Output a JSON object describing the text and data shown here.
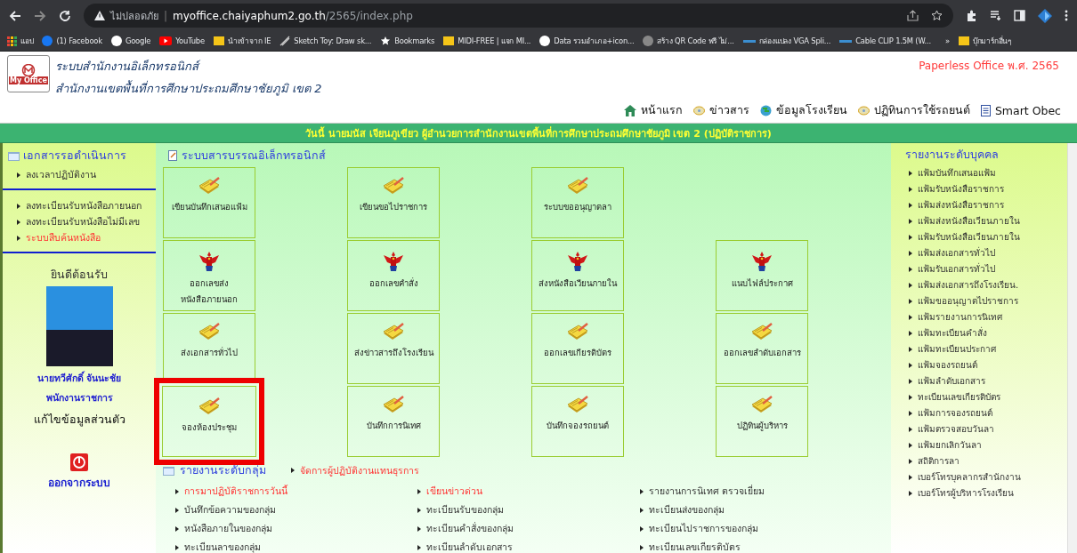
{
  "browser": {
    "security": "ไม่ปลอดภัย",
    "separator": "|",
    "url_host": "myoffice.chaiyaphum2.go.th",
    "url_path": "/2565/index.php",
    "bookmarks": [
      {
        "kind": "apps",
        "label": "แอป"
      },
      {
        "kind": "facebook",
        "label": "(1) Facebook"
      },
      {
        "kind": "google",
        "label": "Google"
      },
      {
        "kind": "youtube",
        "label": "YouTube"
      },
      {
        "kind": "folder",
        "label": "นำเข้าจาก IE"
      },
      {
        "kind": "sketch",
        "label": "Sketch Toy: Draw sk..."
      },
      {
        "kind": "star",
        "label": "Bookmarks"
      },
      {
        "kind": "midi",
        "label": "MIDI-FREE | แจก MI..."
      },
      {
        "kind": "google",
        "label": "Data รวมอำเภอ+icon..."
      },
      {
        "kind": "qr",
        "label": "สร้าง QR Code ฟรี ไม่..."
      },
      {
        "kind": "line",
        "label": "กล่องแปลง VGA Spli..."
      },
      {
        "kind": "line",
        "label": "Cable CLIP 1.5M (W..."
      }
    ],
    "more": "»",
    "other_bookmarks": "บุ๊กมาร์กอื่นๆ"
  },
  "header": {
    "logo_text": "My Office",
    "title": "ระบบสำนักงานอิเล็กทรอนิกส์",
    "subtitle": "สำนักงานเขตพื้นที่การศึกษาประถมศึกษาชัยภูมิ เขต 2",
    "edition": "Paperless Office พ.ศ. 2565",
    "nav": [
      {
        "kind": "home",
        "label": "หน้าแรก"
      },
      {
        "kind": "disc",
        "label": "ข่าวสาร"
      },
      {
        "kind": "globe",
        "label": "ข้อมูลโรงเรียน"
      },
      {
        "kind": "disc",
        "label": "ปฏิทินการใช้รถยนต์"
      },
      {
        "kind": "doc",
        "label": "Smart Obec"
      }
    ]
  },
  "status_banner": "วันนี้ นายมนัส เจียนภูเขียว ผู้อำนวยการสำนักงานเขตพื้นที่การศึกษาประถมศึกษาชัยภูมิ เขต 2 (ปฏิบัติราชการ)",
  "left_sidebar": {
    "heading": "เอกสารรอดำเนินการ",
    "groups": [
      [
        {
          "label": "ลงเวลาปฏิบัติงาน",
          "highlighted": false
        }
      ],
      [
        {
          "label": "ลงทะเบียนรับหนังสือภายนอก",
          "highlighted": false
        },
        {
          "label": "ลงทะเบียนรับหนังสือไม่มีเลข",
          "highlighted": false
        },
        {
          "label": "ระบบสืบค้นหนังสือ",
          "highlighted": true
        }
      ]
    ],
    "welcome": "ยินดีต้อนรับ",
    "user_name": "นายทวีศักดิ์ จันนะชัย",
    "user_position": "พนักงานราชการ",
    "edit_profile": "แก้ไขข้อมูลส่วนตัว",
    "logout": "ออกจากระบบ"
  },
  "main": {
    "heading": "ระบบสารบรรณอิเล็กทรอนิกส์",
    "tile_rows": [
      [
        {
          "kind": "notepad",
          "lines": [
            "เขียนบันทึกเสนอแฟ้ม"
          ],
          "highlighted": false
        },
        {
          "kind": "notepad",
          "lines": [
            "เขียนขอไปราชการ"
          ],
          "highlighted": false
        },
        {
          "kind": "notepad",
          "lines": [
            "ระบบขออนุญาตลา"
          ],
          "highlighted": false
        }
      ],
      [
        {
          "kind": "garuda",
          "lines": [
            "ออกเลขส่ง",
            "หนังสือภายนอก"
          ],
          "highlighted": false
        },
        {
          "kind": "garuda",
          "lines": [
            "ออกเลขคำสั่ง"
          ],
          "highlighted": false
        },
        {
          "kind": "garuda",
          "lines": [
            "ส่งหนังสือเวียนภายใน"
          ],
          "highlighted": false
        },
        {
          "kind": "garuda",
          "lines": [
            "แนบไฟล์ประกาศ"
          ],
          "highlighted": false
        }
      ],
      [
        {
          "kind": "notepad",
          "lines": [
            "ส่งเอกสารทั่วไป"
          ],
          "highlighted": false
        },
        {
          "kind": "notepad",
          "lines": [
            "ส่งข่าวสารถึงโรงเรียน"
          ],
          "highlighted": false
        },
        {
          "kind": "notepad",
          "lines": [
            "ออกเลขเกียรติบัตร"
          ],
          "highlighted": false
        },
        {
          "kind": "notepad",
          "lines": [
            "ออกเลขลำดับเอกสาร"
          ],
          "highlighted": false
        }
      ],
      [
        {
          "kind": "notepad",
          "lines": [
            "จองห้องประชุม"
          ],
          "highlighted": true
        },
        {
          "kind": "notepad",
          "lines": [
            "บันทึกการนิเทศ"
          ],
          "highlighted": false
        },
        {
          "kind": "notepad",
          "lines": [
            "บันทึกจองรถยนต์"
          ],
          "highlighted": false
        },
        {
          "kind": "notepad",
          "lines": [
            "ปฏิทินผู้บริหาร"
          ],
          "highlighted": false
        }
      ]
    ],
    "group_heading": "รายงานระดับกลุ่ม",
    "group_manage": "จัดการผู้ปฏิบัติงานแทนธุรการ",
    "group_links": [
      [
        {
          "label": "การมาปฏิบัติราชการวันนี้",
          "highlighted": true
        },
        {
          "label": "บันทึกข้อความของกลุ่ม",
          "highlighted": false
        },
        {
          "label": "หนังสือภายในของกลุ่ม",
          "highlighted": false
        },
        {
          "label": "ทะเบียนลาของกลุ่ม",
          "highlighted": false
        }
      ],
      [
        {
          "label": "เขียนข่าวด่วน",
          "highlighted": true
        },
        {
          "label": "ทะเบียนรับของกลุ่ม",
          "highlighted": false
        },
        {
          "label": "ทะเบียนคำสั่งของกลุ่ม",
          "highlighted": false
        },
        {
          "label": "ทะเบียนลำดับเอกสาร",
          "highlighted": false
        }
      ],
      [
        {
          "label": "รายงานการนิเทศ ตรวจเยี่ยม",
          "highlighted": false
        },
        {
          "label": "ทะเบียนส่งของกลุ่ม",
          "highlighted": false
        },
        {
          "label": "ทะเบียนไปราชการของกลุ่ม",
          "highlighted": false
        },
        {
          "label": "ทะเบียนเลขเกียรติบัตร",
          "highlighted": false
        }
      ]
    ]
  },
  "right_sidebar": {
    "heading": "รายงานระดับบุคคล",
    "items": [
      "แฟ้มบันทึกเสนอแฟ้ม",
      "แฟ้มรับหนังสือราชการ",
      "แฟ้มส่งหนังสือราชการ",
      "แฟ้มส่งหนังสือเวียนภายใน",
      "แฟ้มรับหนังสือเวียนภายใน",
      "แฟ้มส่งเอกสารทั่วไป",
      "แฟ้มรับเอกสารทั่วไป",
      "แฟ้มส่งเอกสารถึงโรงเรียน.",
      "แฟ้มขออนุญาตไปราชการ",
      "แฟ้มรายงานการนิเทศ",
      "แฟ้มทะเบียนคำสั่ง",
      "แฟ้มทะเบียนประกาศ",
      "แฟ้มจองรถยนต์",
      "แฟ้มลำดับเอกสาร",
      "ทะเบียนเลขเกียรติบัตร",
      "แฟ้มการจองรถยนต์",
      "แฟ้มตรวจสอบวันลา",
      "แฟ้มยกเลิกวันลา",
      "สถิติการลา",
      "เบอร์โทรบุคลากรสำนักงาน",
      "เบอร์โทรผู้บริหารโรงเรียน"
    ]
  }
}
